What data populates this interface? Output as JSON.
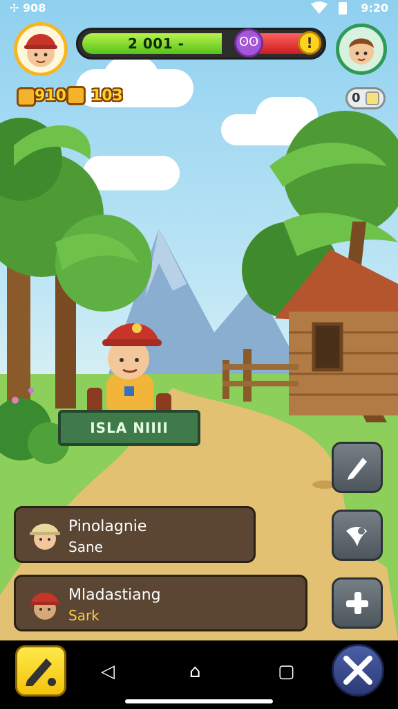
{
  "status_bar": {
    "left_text": "✢ 908",
    "right_text": "9:20"
  },
  "hud": {
    "health_value": "2 001 -",
    "skull_glyph": "ʘʘ",
    "coin_glyph": "!",
    "resources": [
      {
        "label": "910",
        "icon": "wing-coin-icon"
      },
      {
        "label": "103",
        "icon": "gold-coin-icon"
      }
    ],
    "right_counter": "0"
  },
  "scene": {
    "sign_text": "ISLA NIIII"
  },
  "cards": [
    {
      "name": "Pinolagnie",
      "sub": "Sane",
      "portrait": "explorer-portrait-icon"
    },
    {
      "name": "Mladastiang",
      "sub": "Sark",
      "portrait": "firefighter-portrait-icon"
    }
  ],
  "side_buttons": [
    {
      "icon": "pencil-icon"
    },
    {
      "icon": "map-pin-icon"
    },
    {
      "icon": "plus-icon"
    }
  ],
  "nav": {
    "left_button_icon": "edit-pencil-icon",
    "right_button_icon": "crossed-swords-icon",
    "back_glyph": "◁",
    "home_glyph": "⌂",
    "recents_glyph": "▢"
  },
  "colors": {
    "health_green": "#55c21b",
    "health_red": "#cc1c1c",
    "accent_gold": "#ffd02a",
    "card_bg": "#5a4632"
  }
}
